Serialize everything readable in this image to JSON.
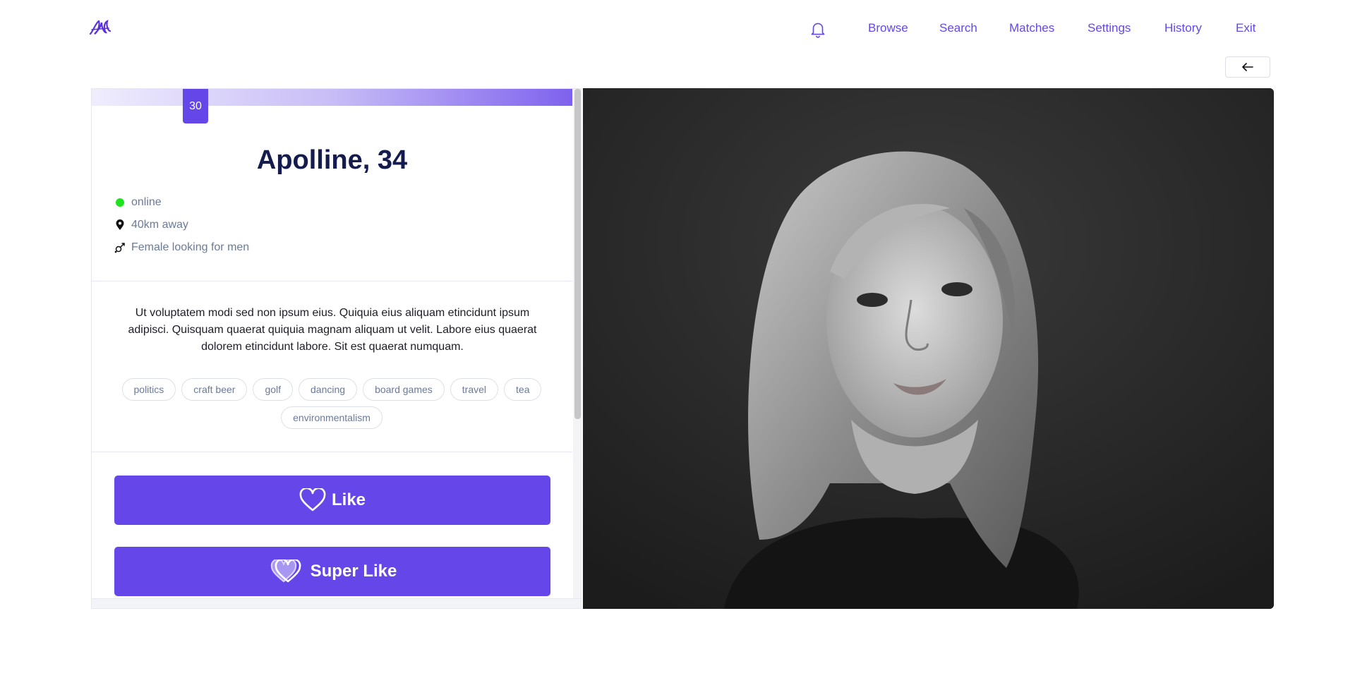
{
  "header": {
    "logo_icon": "script-logo-icon",
    "notification_icon": "bell-icon",
    "nav": [
      {
        "label": "Browse"
      },
      {
        "label": "Search"
      },
      {
        "label": "Matches"
      },
      {
        "label": "Settings"
      },
      {
        "label": "History"
      },
      {
        "label": "Exit"
      }
    ],
    "back_icon": "arrow-left-icon"
  },
  "profile": {
    "progress_value": "30",
    "name_age": "Apolline, 34",
    "status": "online",
    "distance": "40km away",
    "orientation": "Female looking for men",
    "bio": "Ut voluptatem modi sed non ipsum eius. Quiquia eius aliquam etincidunt ipsum adipisci. Quisquam quaerat quiquia magnam aliquam ut velit. Labore eius quaerat dolorem etincidunt labore. Sit est quaerat numquam.",
    "tags": [
      "politics",
      "craft beer",
      "golf",
      "dancing",
      "board games",
      "travel",
      "tea",
      "environmentalism"
    ],
    "like_label": "Like",
    "super_like_label": "Super Like"
  },
  "colors": {
    "accent": "#6546e9",
    "title": "#141b4d",
    "online": "#1ee31e",
    "muted": "#6b7a96"
  }
}
